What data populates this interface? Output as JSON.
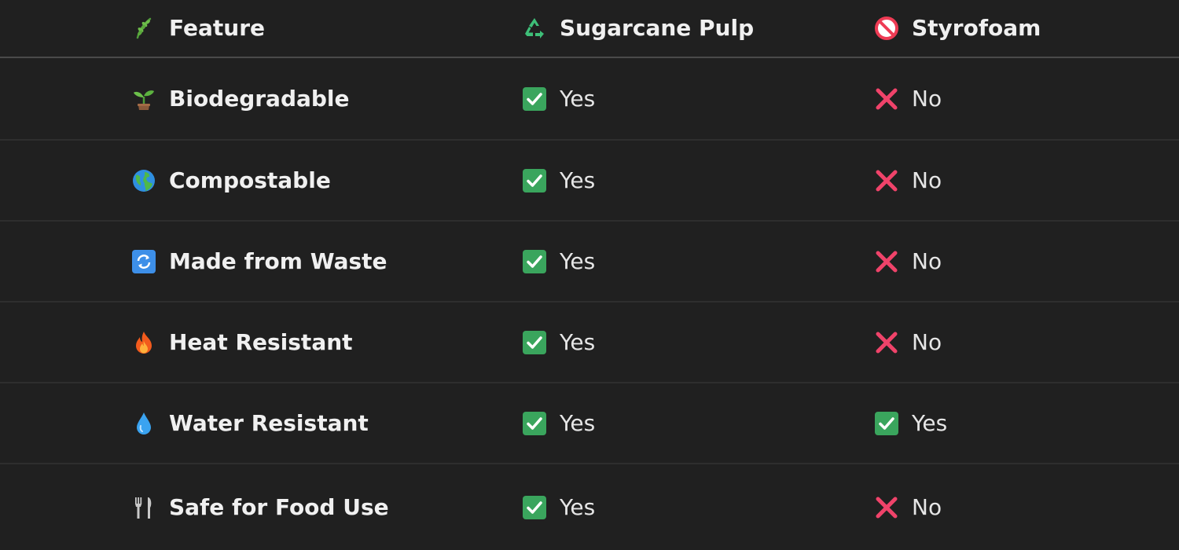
{
  "header": {
    "feature_label": "Feature",
    "feature_icon": "herb-icon",
    "sugarcane_label": "Sugarcane Pulp",
    "sugarcane_icon": "recycle-icon",
    "styrofoam_label": "Styrofoam",
    "styrofoam_icon": "prohibited-icon"
  },
  "rows": [
    {
      "feature": "Biodegradable",
      "feature_icon": "seedling-icon",
      "sugarcane": "Yes",
      "styrofoam": "No"
    },
    {
      "feature": "Compostable",
      "feature_icon": "globe-icon",
      "sugarcane": "Yes",
      "styrofoam": "No"
    },
    {
      "feature": "Made from Waste",
      "feature_icon": "arrows-cycle-icon",
      "sugarcane": "Yes",
      "styrofoam": "No"
    },
    {
      "feature": "Heat Resistant",
      "feature_icon": "fire-icon",
      "sugarcane": "Yes",
      "styrofoam": "No"
    },
    {
      "feature": "Water Resistant",
      "feature_icon": "droplet-icon",
      "sugarcane": "Yes",
      "styrofoam": "Yes"
    },
    {
      "feature": "Safe for Food Use",
      "feature_icon": "fork-knife-icon",
      "sugarcane": "Yes",
      "styrofoam": "No"
    }
  ],
  "colors": {
    "background": "#202020",
    "check_green": "#3aa55d",
    "cross_red": "#f0436a"
  }
}
